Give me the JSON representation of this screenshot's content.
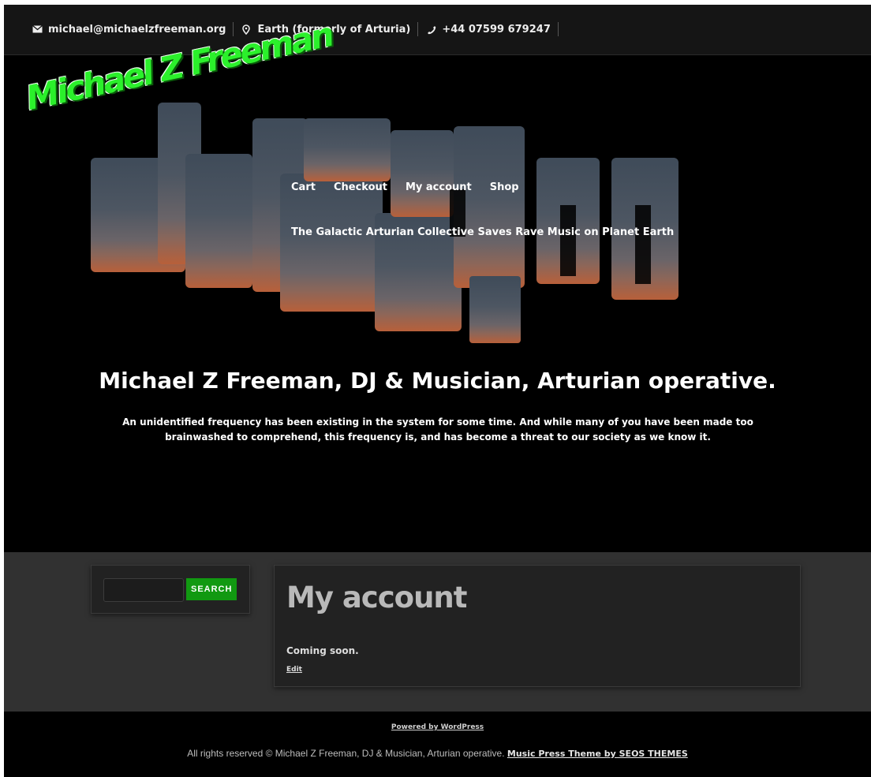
{
  "topbar": {
    "email": "michael@michaelzfreeman.org",
    "location": "Earth (formerly of Arturia)",
    "phone": "+44 07599 679247"
  },
  "logo": {
    "text": "Michael Z Freeman"
  },
  "nav": {
    "items": [
      "Cart",
      "Checkout",
      "My account",
      "Shop"
    ]
  },
  "hero": {
    "tagline": "The Galactic Arturian Collective Saves Rave Music on Planet Earth",
    "title": "Michael Z Freeman, DJ & Musician, Arturian operative.",
    "description": "An unidentified frequency has been existing in the system for some time. And while many of you have been made too brainwashed to comprehend, this frequency is, and has become a threat to our society as we know it."
  },
  "search": {
    "button_label": "SEARCH"
  },
  "article": {
    "title": "My account",
    "body": "Coming soon.",
    "edit_label": "Edit"
  },
  "footer": {
    "powered": "Powered by WordPress",
    "copyright": "All rights reserved © Michael Z Freeman, DJ & Musician, Arturian operative.",
    "theme_link": "Music Press Theme by SEOS THEMES"
  },
  "colors": {
    "background": "#000000",
    "content_bg": "#313131",
    "card_bg": "#222222",
    "search_button": "#119911",
    "logo_green": "#2bf02b"
  }
}
